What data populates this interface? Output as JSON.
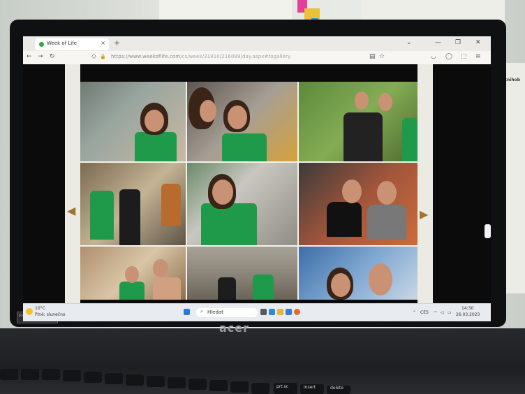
{
  "browser": {
    "tab_title": "Week of Life",
    "tab_close": "×",
    "new_tab": "+",
    "url_domain": "https://www.weekoflife.com",
    "url_path": "/cs/week/31810/216089/day.aspx#togallery",
    "nav": {
      "back": "←",
      "forward": "→",
      "reload": "↻",
      "shield": "◇",
      "lock": "🔒"
    },
    "window_controls": {
      "chevron": "⌄",
      "minimize": "—",
      "restore": "❐",
      "close": "✕"
    },
    "toolbar_icons": {
      "reader": "▤",
      "bookmark": "☆",
      "pocket": "◡",
      "account": "◯",
      "extensions": "⬚",
      "menu": "≡"
    }
  },
  "gallery": {
    "prev_arrow": "◀",
    "next_arrow": "▶"
  },
  "taskbar": {
    "weather_temp": "10°C",
    "weather_desc": "Plné: slunečno",
    "search_placeholder": "Hledat",
    "time": "14:30",
    "date": "26.03.2023",
    "lang": "CES"
  },
  "hardware": {
    "brand": "acer",
    "badge_text": "1080p",
    "badge_mark": "FHD"
  },
  "desk": {
    "side_label": "knihob"
  },
  "keyboard": {
    "prtsc": "prt.sc",
    "insert": "insert",
    "delete": "delete"
  },
  "colors": {
    "accent_green": "#1f9a4a",
    "page_beige": "#ecebe3",
    "arrow_gold": "#a0752c"
  }
}
